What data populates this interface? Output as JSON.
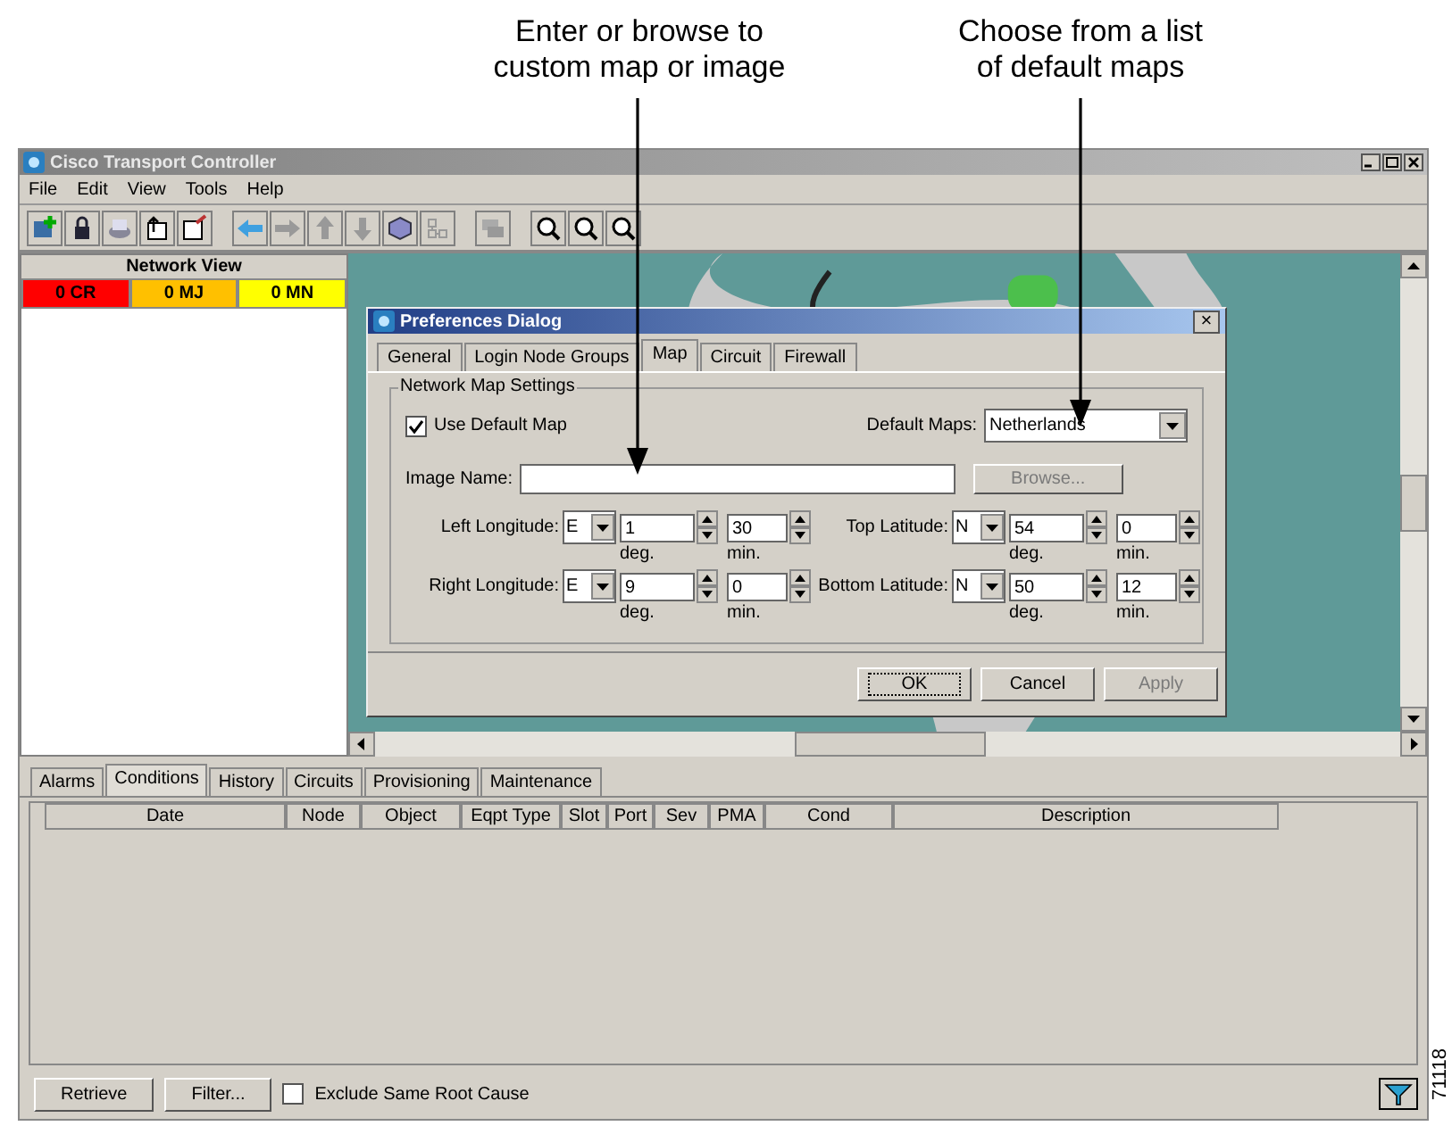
{
  "callouts": [
    {
      "text": "Enter or browse to\ncustom map or image"
    },
    {
      "text": "Choose from a list\nof default maps"
    }
  ],
  "window": {
    "title": "Cisco Transport Controller"
  },
  "menu": [
    "File",
    "Edit",
    "View",
    "Tools",
    "Help"
  ],
  "network_view": {
    "title": "Network View",
    "alarms": [
      {
        "label": "0 CR",
        "color": "#ff0000"
      },
      {
        "label": "0 MJ",
        "color": "#ffc000"
      },
      {
        "label": "0 MN",
        "color": "#ffff00"
      }
    ]
  },
  "dialog": {
    "title": "Preferences Dialog",
    "close": "×",
    "tabs": [
      {
        "label": "General",
        "selected": false
      },
      {
        "label": "Login Node Groups",
        "selected": false
      },
      {
        "label": "Map",
        "selected": true
      },
      {
        "label": "Circuit",
        "selected": false
      },
      {
        "label": "Firewall",
        "selected": false
      }
    ],
    "group_title": "Network Map Settings",
    "use_default_map": {
      "label": "Use Default Map",
      "checked": true
    },
    "default_maps": {
      "label": "Default Maps:",
      "value": "Netherlands"
    },
    "image_name": {
      "label": "Image Name:"
    },
    "browse": {
      "label": "Browse...",
      "disabled": true
    },
    "coordinates": [
      {
        "label": "Left Longitude:",
        "direction": "E",
        "deg": "1",
        "min": "30",
        "deg_unit": "deg.",
        "min_unit": "min."
      },
      {
        "label": "Top Latitude:",
        "direction": "N",
        "deg": "54",
        "min": "0",
        "deg_unit": "deg.",
        "min_unit": "min."
      },
      {
        "label": "Right Longitude:",
        "direction": "E",
        "deg": "9",
        "min": "0",
        "deg_unit": "deg.",
        "min_unit": "min."
      },
      {
        "label": "Bottom Latitude:",
        "direction": "N",
        "deg": "50",
        "min": "12",
        "deg_unit": "deg.",
        "min_unit": "min."
      }
    ],
    "buttons": [
      {
        "label": "OK",
        "disabled": false,
        "focused": true
      },
      {
        "label": "Cancel",
        "disabled": false,
        "focused": false
      },
      {
        "label": "Apply",
        "disabled": true,
        "focused": false
      }
    ]
  },
  "bottom_tabs": [
    {
      "label": "Alarms",
      "selected": false
    },
    {
      "label": "Conditions",
      "selected": true
    },
    {
      "label": "History",
      "selected": false
    },
    {
      "label": "Circuits",
      "selected": false
    },
    {
      "label": "Provisioning",
      "selected": false
    },
    {
      "label": "Maintenance",
      "selected": false
    }
  ],
  "table": {
    "columns": [
      "Date",
      "Node",
      "Object",
      "Eqpt Type",
      "Slot",
      "Port",
      "Sev",
      "PMA",
      "Cond",
      "Description"
    ]
  },
  "bottom_bar": {
    "retrieve": "Retrieve",
    "filter": "Filter...",
    "exclude": {
      "label": "Exclude Same Root Cause",
      "checked": false
    }
  },
  "figure_number": "71118"
}
